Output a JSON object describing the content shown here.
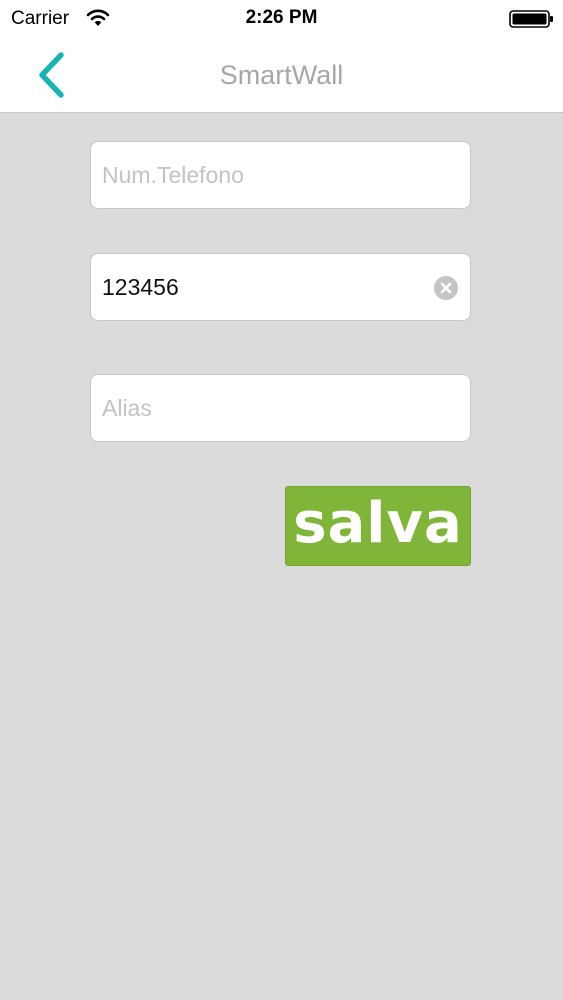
{
  "status_bar": {
    "carrier": "Carrier",
    "time": "2:26 PM",
    "wifi_icon": "wifi-icon",
    "battery_icon": "battery-icon"
  },
  "nav": {
    "title": "SmartWall",
    "back_icon": "chevron-left-icon",
    "accent_color": "#1ab3b3"
  },
  "form": {
    "phone": {
      "placeholder": "Num.Telefono",
      "value": ""
    },
    "code": {
      "placeholder": "",
      "value": "123456",
      "clear_icon": "clear-icon"
    },
    "alias": {
      "placeholder": "Alias",
      "value": ""
    },
    "save_label": "salva",
    "save_color": "#80b53a"
  }
}
